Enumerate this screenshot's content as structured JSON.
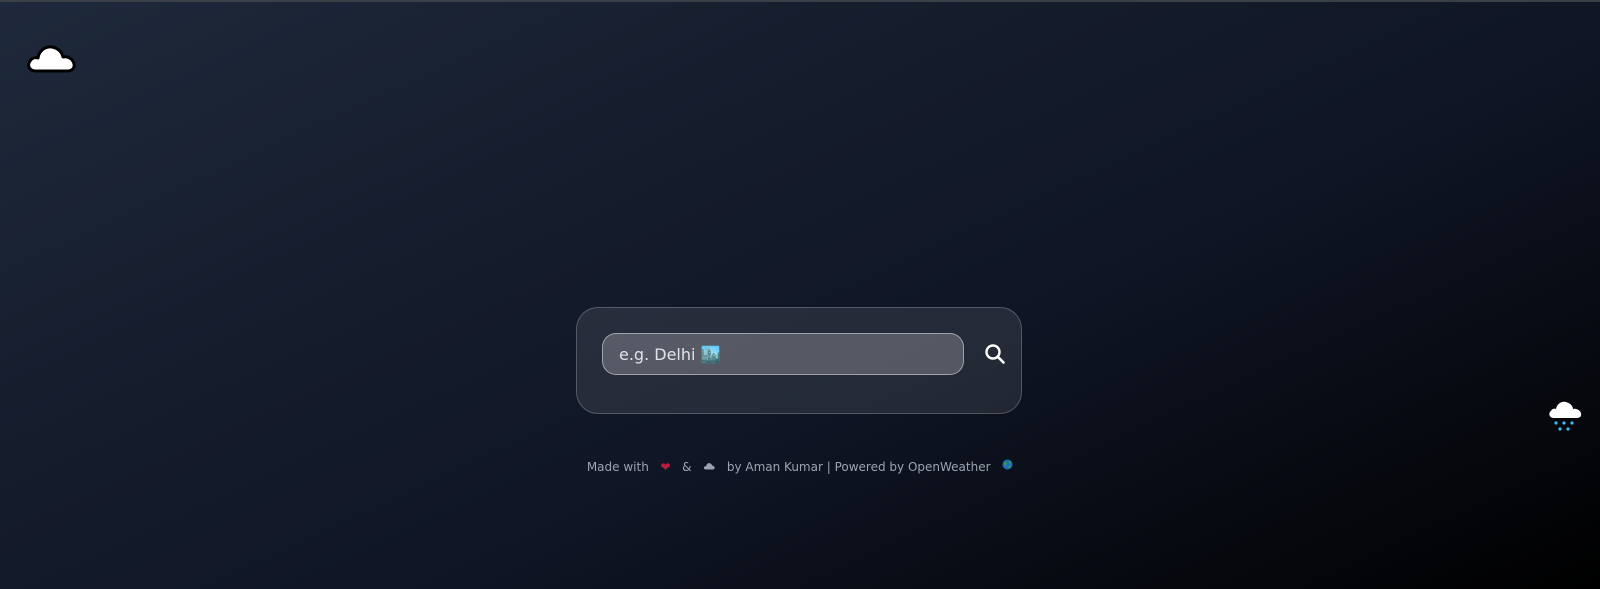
{
  "decorations": {
    "left_icon": "cloud-icon",
    "right_icon": "rain-cloud-icon"
  },
  "search": {
    "placeholder": "e.g. Delhi 🏙️",
    "value": "",
    "button_icon": "search-icon"
  },
  "footer": {
    "made_with": "Made with",
    "heart": "❤",
    "ampersand": "&",
    "cloud_icon": "cloud-icon",
    "by_author": "by Aman Kumar | Powered by OpenWeather",
    "globe_icon": "globe-icon"
  },
  "colors": {
    "background_start": "#1e293b",
    "background_end": "#000000",
    "heart": "#b91c3c",
    "rain": "#38bdf8",
    "footer_text": "#9ca3af"
  }
}
